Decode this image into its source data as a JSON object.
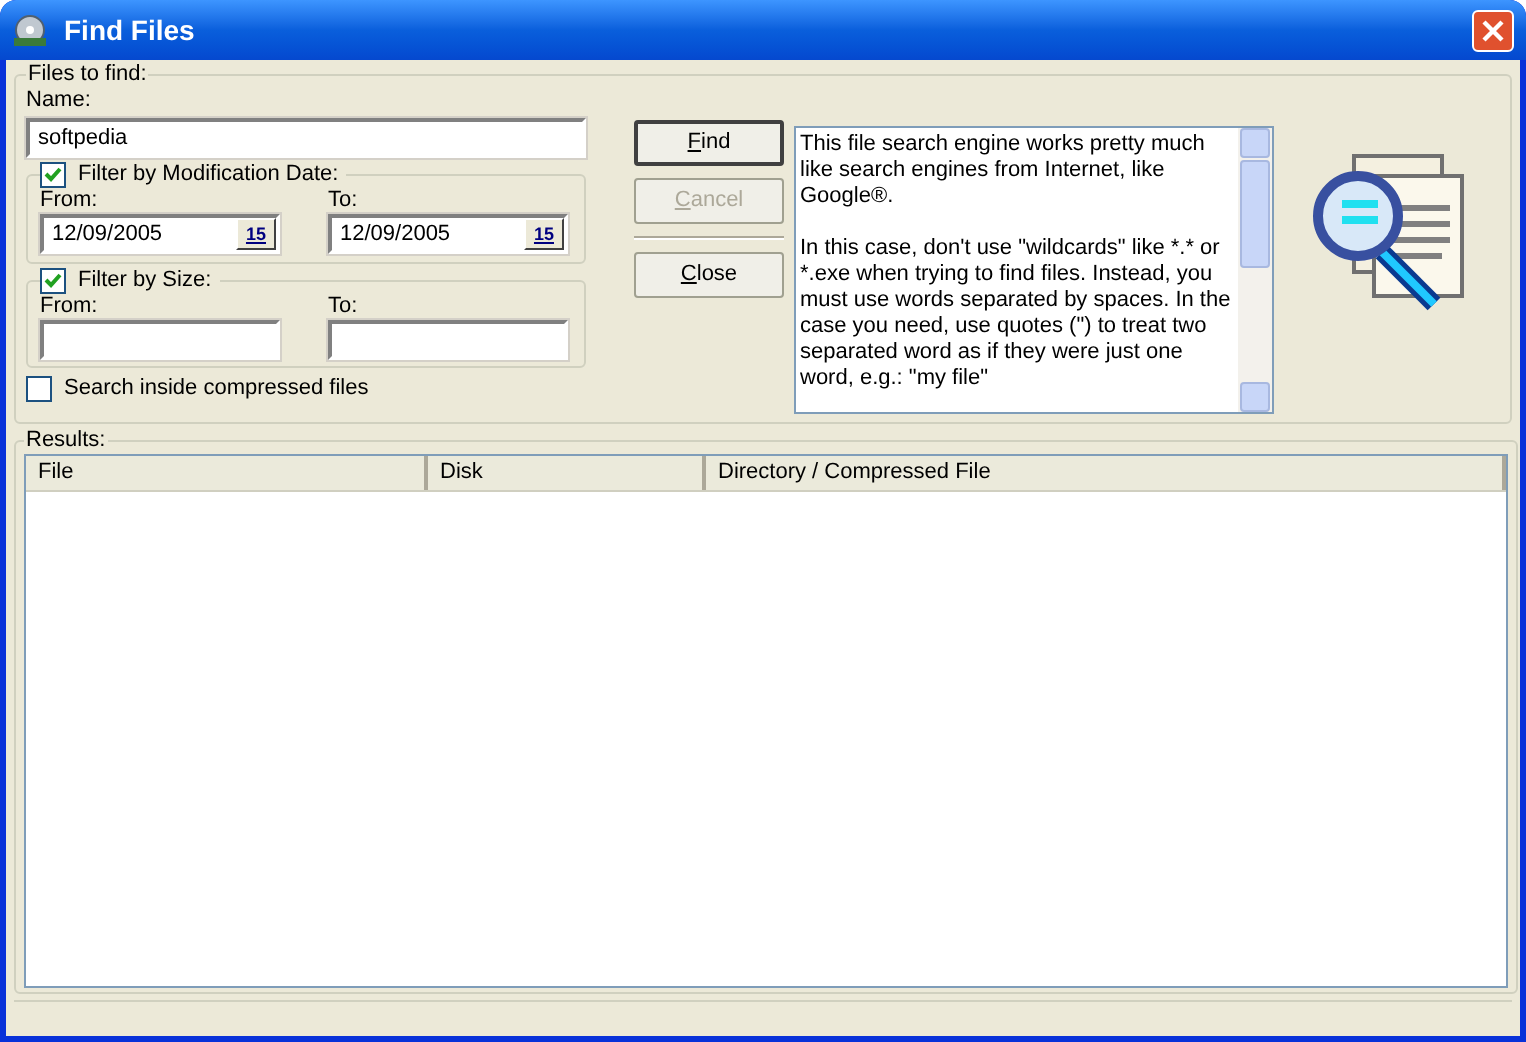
{
  "window": {
    "title": "Find Files"
  },
  "files_to_find": {
    "label": "Files to find:",
    "name_label": "Name:",
    "name_value": "softpedia",
    "date_filter": {
      "label": "Filter by Modification Date:",
      "checked": true,
      "from_label": "From:",
      "from_value": "12/09/2005",
      "to_label": "To:",
      "to_value": "12/09/2005",
      "from_calendar_label": "15",
      "to_calendar_label": "15"
    },
    "size_filter": {
      "label": "Filter by Size:",
      "checked": true,
      "from_label": "From:",
      "to_label": "To:"
    },
    "compressed": {
      "label": "Search inside compressed files",
      "checked": false
    }
  },
  "buttons": [
    {
      "label": "Find",
      "default": true,
      "disabled": false
    },
    {
      "label": "Cancel",
      "default": false,
      "disabled": true
    },
    {
      "label": "Close",
      "default": false,
      "disabled": false
    }
  ],
  "help_text": [
    "This file search engine works pretty much like search engines from Internet, like Google®.",
    "In this case, don't use \"wildcards\" like *.* or *.exe when trying to find files. Instead, you must use words separated by spaces. In the case you need, use quotes (\") to treat two separated word as if they were just one word, e.g.: \"my file\""
  ],
  "results": {
    "label": "Results:",
    "columns": [
      "File",
      "Disk",
      "Directory / Compressed File"
    ]
  }
}
